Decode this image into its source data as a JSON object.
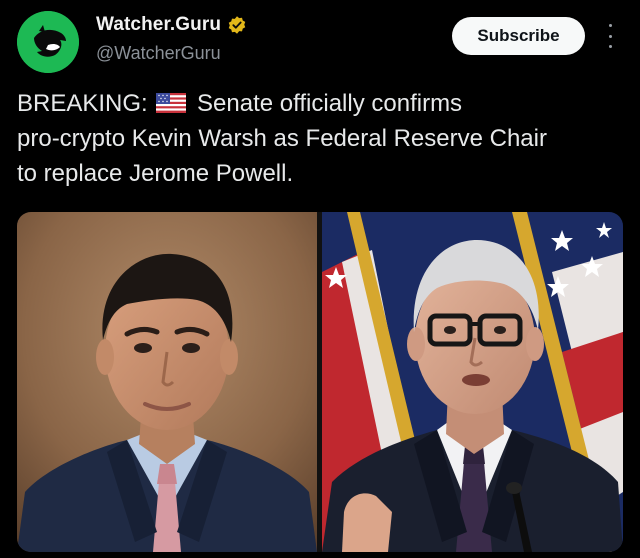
{
  "account": {
    "display_name": "Watcher.Guru",
    "handle": "@WatcherGuru",
    "verified": true,
    "avatar_icon": "watcher-guru-logo-icon",
    "avatar_color": "#1db954"
  },
  "actions": {
    "subscribe_label": "Subscribe",
    "more_icon": "more-vertical-icon"
  },
  "post": {
    "text_line1_prefix": "BREAKING:",
    "flag_icon": "us-flag-emoji",
    "text_line1_suffix": "Senate officially confirms",
    "text_line2": "pro-crypto Kevin Warsh as Federal Reserve Chair",
    "text_line3": "to replace Jerome Powell."
  },
  "media": {
    "images": [
      {
        "name": "portrait-left"
      },
      {
        "name": "portrait-right"
      }
    ]
  },
  "colors": {
    "background": "#000000",
    "text": "#e7e9ea",
    "handle": "#8b9198",
    "verified_badge": "#e2b719",
    "button_bg": "#f7f9f9"
  }
}
